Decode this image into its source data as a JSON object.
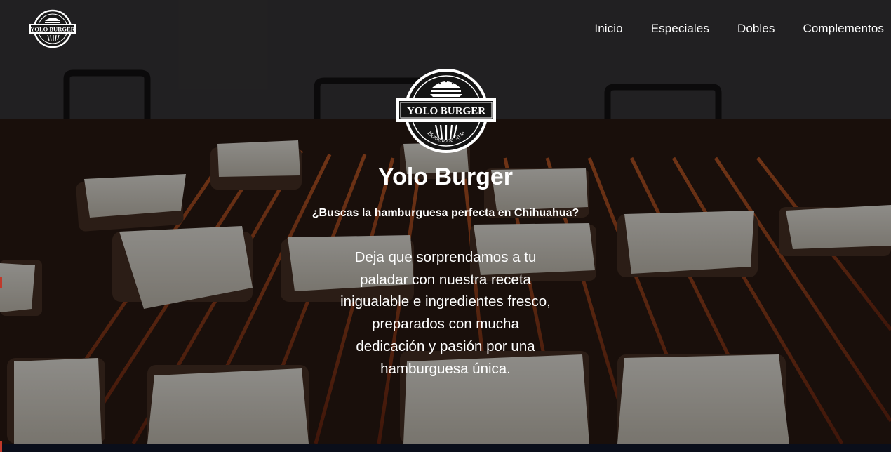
{
  "brand": {
    "logo_text": "YOLO BURGER",
    "logo_tagline": "Homemade Style"
  },
  "nav": {
    "items": [
      {
        "label": "Inicio"
      },
      {
        "label": "Especiales"
      },
      {
        "label": "Dobles"
      },
      {
        "label": "Complementos"
      }
    ]
  },
  "hero": {
    "title": "Yolo Burger",
    "subtitle": "¿Buscas la hamburguesa perfecta en Chihuahua?",
    "description": "Deja que sorprendamos a tu paladar con nuestra receta inigualable e ingredientes fresco, preparados con mucha dedicación y pasión por una hamburguesa única."
  },
  "colors": {
    "text": "#ffffff",
    "overlay": "#000000",
    "footer_bar": "#0a0e1a",
    "edge_accent": "#c0392b"
  }
}
